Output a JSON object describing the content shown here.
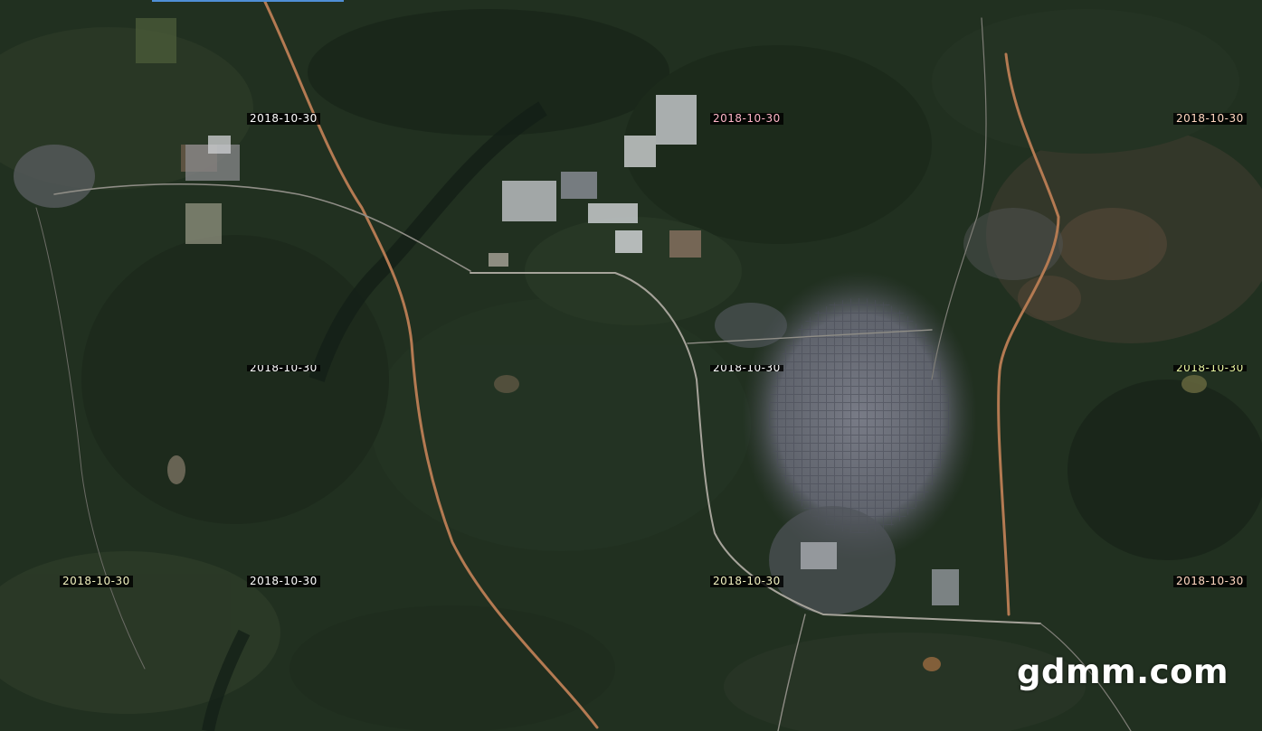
{
  "map": {
    "tile_date": "2018-10-30",
    "watermark": "gdmm.com"
  },
  "colors": {
    "vegetation": "#213020",
    "vegetation_dark": "#182418",
    "field": "#3a4a2c",
    "urban": "#6a6d78",
    "road_orange": "#b47a52",
    "road_grey": "#a6a39a",
    "water": "#142018",
    "label_white": "#ffffff",
    "label_pink": "#ffb6c8",
    "label_peach": "#ffd7c0",
    "label_yellow": "#f2f2c0",
    "selection_bar": "#4f8fd6"
  },
  "date_labels": [
    {
      "text": "2018-10-30",
      "color": "#ffffff"
    },
    {
      "text": "2018-10-30",
      "color": "#ffb6c8"
    },
    {
      "text": "2018-10-30",
      "color": "#ffd7c0"
    },
    {
      "text": "2018-10-30",
      "color": "#ffffff"
    },
    {
      "text": "2018-10-30",
      "color": "#ffffff"
    },
    {
      "text": "2018-10-30",
      "color": "#e8f5a0"
    },
    {
      "text": "2018-10-30",
      "color": "#f2f2c0"
    },
    {
      "text": "2018-10-30",
      "color": "#ffffff"
    },
    {
      "text": "2018-10-30",
      "color": "#f2f2c0"
    },
    {
      "text": "2018-10-30",
      "color": "#ffd7c0"
    }
  ]
}
